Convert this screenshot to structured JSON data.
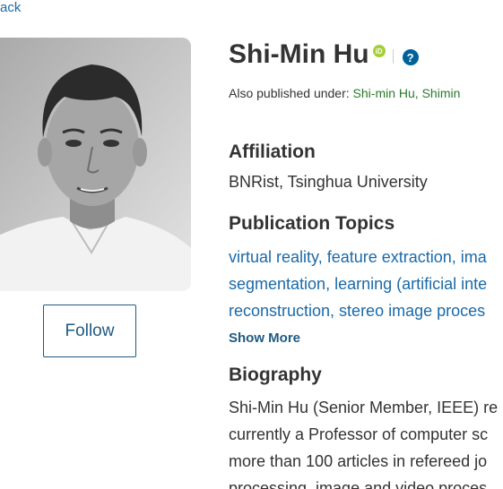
{
  "nav": {
    "back_label": "ack"
  },
  "profile": {
    "name": "Shi-Min Hu",
    "orcid_badge": "iD",
    "help_badge": "?",
    "also_published_label": "Also published under:",
    "alt_names": [
      "Shi-min Hu,",
      "Shimin"
    ],
    "follow_label": "Follow"
  },
  "affiliation": {
    "title": "Affiliation",
    "value": "BNRist, Tsinghua University"
  },
  "topics": {
    "title": "Publication Topics",
    "lines": [
      "virtual reality, feature extraction, ima",
      "segmentation, learning (artificial inte",
      "reconstruction, stereo image proces"
    ],
    "show_more_label": "Show More"
  },
  "biography": {
    "title": "Biography",
    "lines": [
      "Shi-Min Hu (Senior Member, IEEE) re",
      "currently a Professor of computer sc",
      "more than 100 articles in refereed jo",
      "processing, image and video proces"
    ]
  },
  "colors": {
    "link": "#1a6aa8",
    "button_border": "#1e5a82",
    "orcid": "#a6ce39",
    "help": "#00629b",
    "alt_name": "#2a7a2a"
  },
  "icons": {
    "orcid": "orcid-icon",
    "help": "help-icon"
  }
}
